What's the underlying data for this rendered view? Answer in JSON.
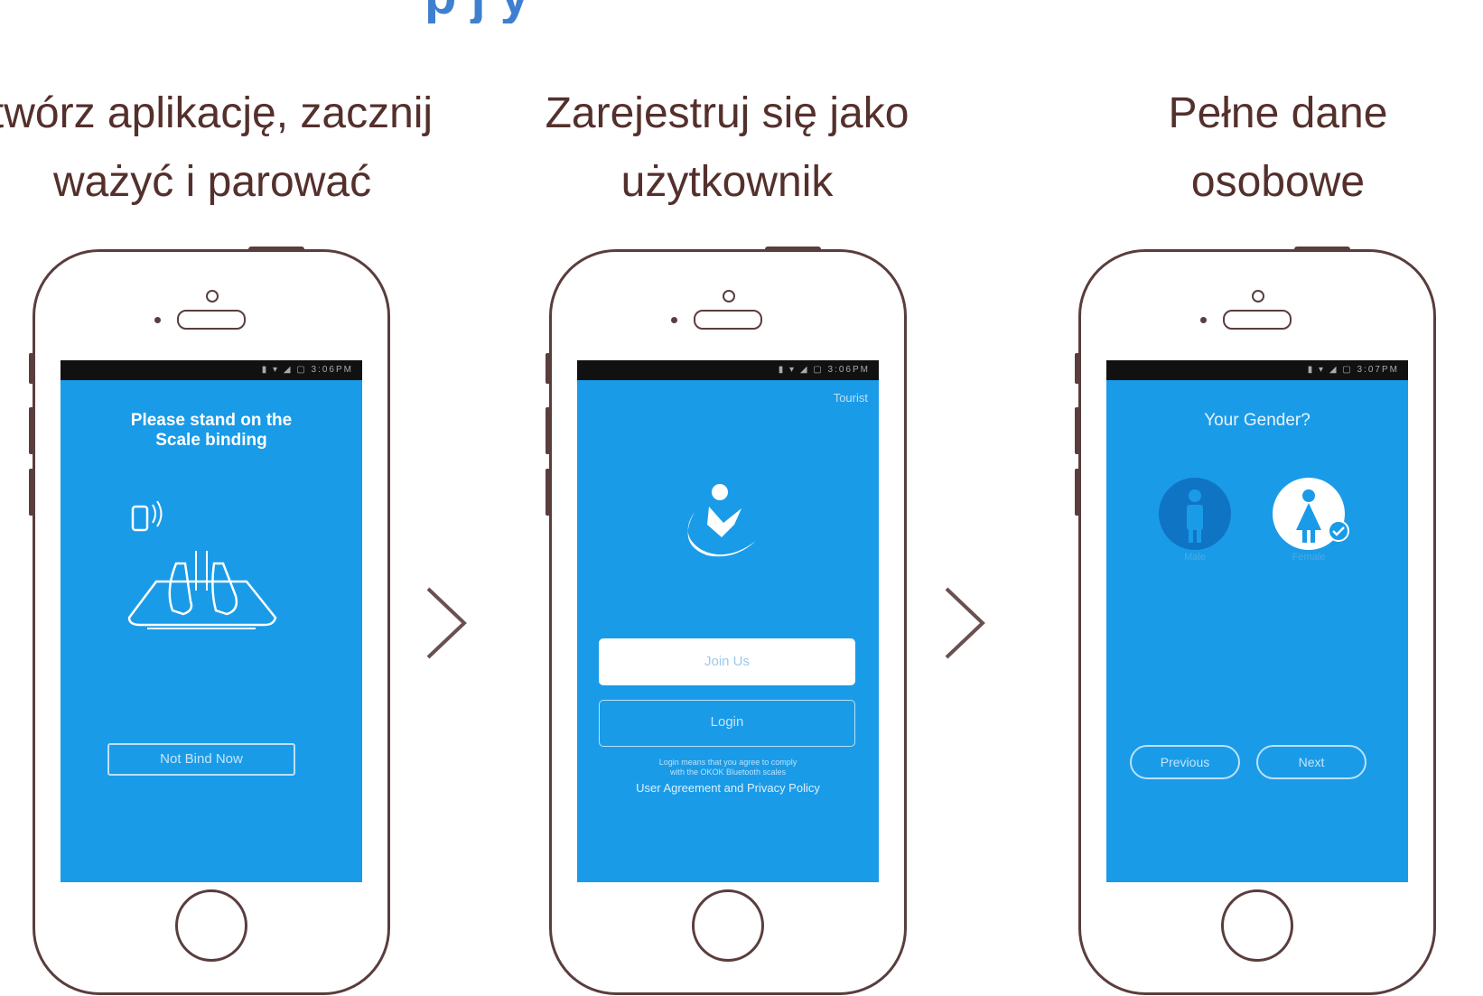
{
  "heading": {
    "partial_text": "p                                         j     y"
  },
  "steps": [
    {
      "title_line1": "twórz aplikację, zacznij",
      "title_line2": "ważyć i parować",
      "screen": {
        "status": "▮ ▾ ◢ ▢ 3:06PM",
        "message_line1": "Please stand on the",
        "message_line2": "Scale binding",
        "button": "Not Bind Now"
      }
    },
    {
      "title_line1": "Zarejestruj się jako",
      "title_line2": "użytkownik",
      "screen": {
        "status": "▮ ▾ ◢ ▢ 3:06PM",
        "tourist": "Tourist",
        "join_button": "Join Us",
        "login_button": "Login",
        "consent_line1": "Login means that you agree to comply",
        "consent_line2": "with the OKOK Bluetooth scales",
        "policy_link": "User Agreement and Privacy Policy"
      }
    },
    {
      "title_line1": "Pełne dane",
      "title_line2": "osobowe",
      "screen": {
        "status": "▮ ▾ ◢ ▢ 3:07PM",
        "question": "Your Gender?",
        "male_label": "Male",
        "female_label": "Female",
        "previous_button": "Previous",
        "next_button": "Next"
      }
    }
  ],
  "colors": {
    "screen": "#1a9be8",
    "title": "#54302c",
    "heading": "#3f7fd0",
    "outline": "#5a3d3d"
  },
  "icons": [
    "phone-signal-icon",
    "feet-on-scale-icon",
    "app-logo-icon",
    "male-icon",
    "female-icon",
    "checkmark-icon",
    "chevron-right-icon"
  ]
}
